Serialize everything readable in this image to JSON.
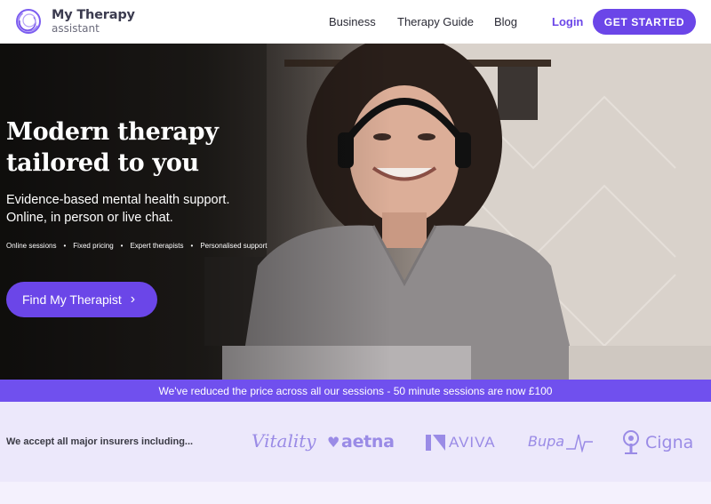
{
  "nav": {
    "logo_title": "My Therapy",
    "logo_subtitle": "assistant",
    "links": [
      "Business",
      "Therapy Guide",
      "Blog"
    ],
    "login": "Login",
    "cta": "GET STARTED"
  },
  "hero": {
    "title_line1": "Modern therapy",
    "title_line2": "tailored to you",
    "subtitle_line1": "Evidence-based mental health support.",
    "subtitle_line2": "Online, in person or live chat.",
    "features": [
      "Online sessions",
      "Fixed pricing",
      "Expert therapists",
      "Personalised support"
    ],
    "button": "Find My Therapist"
  },
  "promo": {
    "text": "We've reduced the price across all our sessions - 50 minute sessions are now £100"
  },
  "insurers": {
    "label": "We accept all major insurers including...",
    "logos": [
      "Vitality",
      "aetna",
      "AVIVA",
      "Bupa",
      "Cigna"
    ]
  },
  "colors": {
    "accent": "#6b46e8",
    "banner": "#7050ee",
    "insurer_logo": "#9a8be6",
    "insurer_bg": "#ece8fb"
  }
}
